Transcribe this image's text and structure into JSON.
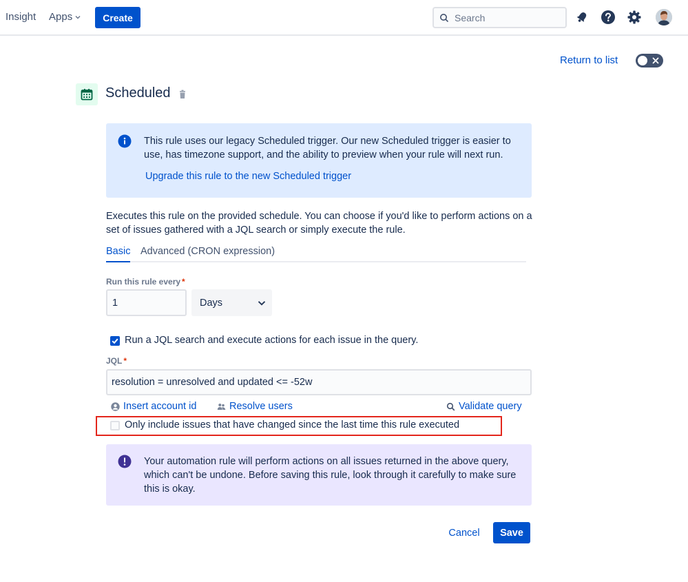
{
  "nav": {
    "insight": "Insight",
    "apps": "Apps",
    "create": "Create",
    "search_placeholder": "Search",
    "icons": [
      "bell-icon",
      "help-icon",
      "gear-icon",
      "avatar"
    ]
  },
  "header": {
    "return_link": "Return to list",
    "title": "Scheduled",
    "rule_enabled": false
  },
  "info": {
    "text": "This rule uses our legacy Scheduled trigger. Our new Scheduled trigger is easier to use, has timezone support, and the ability to preview when your rule will next run.",
    "link": "Upgrade this rule to the new Scheduled trigger"
  },
  "description": "Executes this rule on the provided schedule. You can choose if you'd like to perform actions on a set of issues gathered with a JQL search or simply execute the rule.",
  "tabs": {
    "basic": "Basic",
    "advanced": "Advanced (CRON expression)",
    "active": "Basic"
  },
  "form": {
    "run_every_label": "Run this rule every",
    "required_mark": "*",
    "run_every_value": "1",
    "unit": "Days",
    "run_jql_checkbox_label": "Run a JQL search and execute actions for each issue in the query.",
    "run_jql_checked": true,
    "jql_label": "JQL",
    "jql_value": "resolution = unresolved and updated <= -52w",
    "insert_account_id": "Insert account id",
    "resolve_users": "Resolve users",
    "validate_query": "Validate query",
    "only_changed_label": "Only include issues that have changed since the last time this rule executed",
    "only_changed_checked": false
  },
  "warning": {
    "text": "Your automation rule will perform actions on all issues returned in the above query, which can't be undone. Before saving this rule, look through it carefully to make sure this is okay."
  },
  "actions": {
    "cancel": "Cancel",
    "save": "Save"
  },
  "colors": {
    "primary": "#0052cc",
    "info_bg": "#deebff",
    "warning_bg": "#eae6ff",
    "highlight": "#e3261c",
    "calendar_bg": "#e3fcef",
    "calendar_fg": "#006644"
  }
}
